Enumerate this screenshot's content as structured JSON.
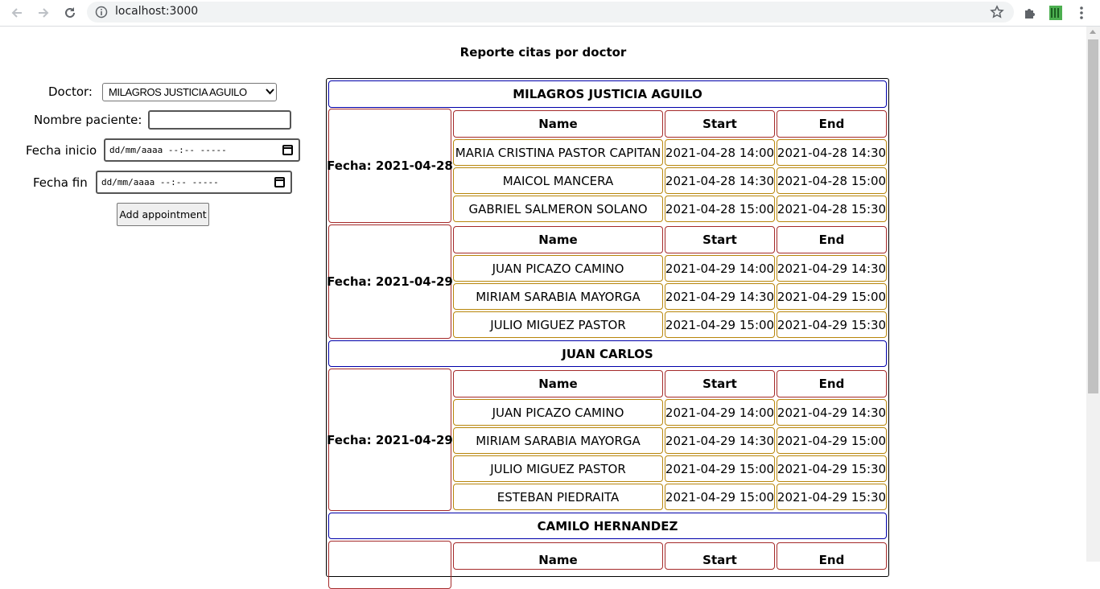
{
  "browser": {
    "url": "localhost:3000"
  },
  "page": {
    "title": "Reporte citas por doctor"
  },
  "form": {
    "doctor_label": "Doctor:",
    "doctor_selected": "MILAGROS JUSTICIA AGUILO",
    "patient_label": "Nombre paciente:",
    "patient_value": "",
    "start_label": "Fecha inicio",
    "start_placeholder": "dd/mm/aaaa --:-- -----",
    "end_label": "Fecha fin",
    "end_placeholder": "dd/mm/aaaa --:-- -----",
    "add_button": "Add appointment"
  },
  "report": {
    "columns": [
      "Name",
      "Start",
      "End"
    ],
    "doctors": [
      {
        "name": "MILAGROS JUSTICIA AGUILO",
        "dates": [
          {
            "label": "Fecha: 2021-04-28",
            "rows": [
              [
                "MARIA CRISTINA PASTOR CAPITAN",
                "2021-04-28 14:00",
                "2021-04-28 14:30"
              ],
              [
                "MAICOL MANCERA",
                "2021-04-28 14:30",
                "2021-04-28 15:00"
              ],
              [
                "GABRIEL SALMERON SOLANO",
                "2021-04-28 15:00",
                "2021-04-28 15:30"
              ]
            ]
          },
          {
            "label": "Fecha: 2021-04-29",
            "rows": [
              [
                "JUAN PICAZO CAMINO",
                "2021-04-29 14:00",
                "2021-04-29 14:30"
              ],
              [
                "MIRIAM SARABIA MAYORGA",
                "2021-04-29 14:30",
                "2021-04-29 15:00"
              ],
              [
                "JULIO MIGUEZ PASTOR",
                "2021-04-29 15:00",
                "2021-04-29 15:30"
              ]
            ]
          }
        ]
      },
      {
        "name": "JUAN CARLOS",
        "dates": [
          {
            "label": "Fecha: 2021-04-29",
            "rows": [
              [
                "JUAN PICAZO CAMINO",
                "2021-04-29 14:00",
                "2021-04-29 14:30"
              ],
              [
                "MIRIAM SARABIA MAYORGA",
                "2021-04-29 14:30",
                "2021-04-29 15:00"
              ],
              [
                "JULIO MIGUEZ PASTOR",
                "2021-04-29 15:00",
                "2021-04-29 15:30"
              ],
              [
                "ESTEBAN PIEDRAITA",
                "2021-04-29 15:00",
                "2021-04-29 15:30"
              ]
            ]
          }
        ]
      },
      {
        "name": "CAMILO HERNANDEZ",
        "dates": [
          {
            "label": "",
            "rows": []
          }
        ]
      }
    ]
  }
}
